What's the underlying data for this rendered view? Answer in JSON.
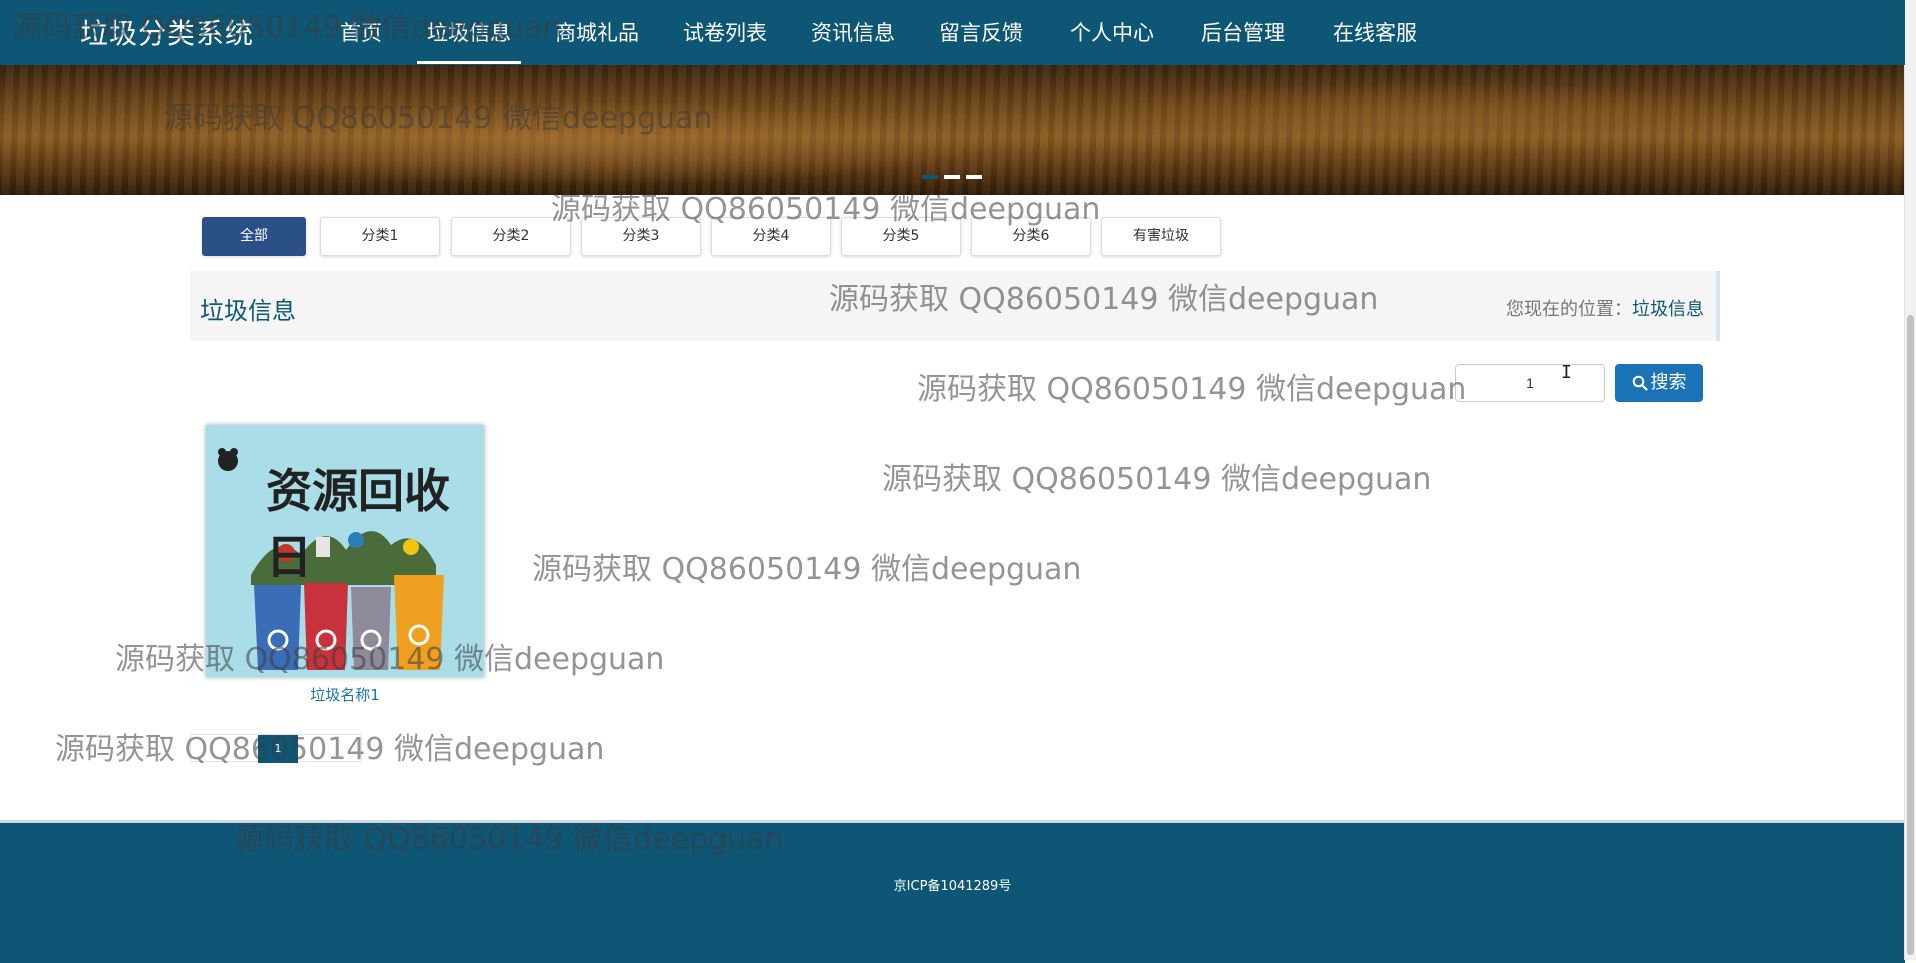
{
  "header": {
    "brand": "垃圾分类系统",
    "nav": [
      "首页",
      "垃圾信息",
      "商城礼品",
      "试卷列表",
      "资讯信息",
      "留言反馈",
      "个人中心",
      "后台管理",
      "在线客服"
    ],
    "active_index": 1
  },
  "banner": {
    "slides": 3,
    "active_slide": 1
  },
  "categories": [
    "全部",
    "分类1",
    "分类2",
    "分类3",
    "分类4",
    "分类5",
    "分类6",
    "有害垃圾"
  ],
  "section": {
    "title": "垃圾信息",
    "breadcrumb_prefix": "您现在的位置：",
    "breadcrumb_current": "垃圾信息"
  },
  "search": {
    "value": "1",
    "button_label": "搜索"
  },
  "cards": [
    {
      "image_text": "资源回收日",
      "name": "垃圾名称1"
    }
  ],
  "pagination": {
    "current": "1"
  },
  "footer": {
    "icp": "京ICP备1041289号"
  },
  "watermark": "源码获取 QQ86050149 微信deepguan",
  "colors": {
    "primary": "#0e5676",
    "active_category": "#2b4f87",
    "search_button": "#1a73b6"
  }
}
